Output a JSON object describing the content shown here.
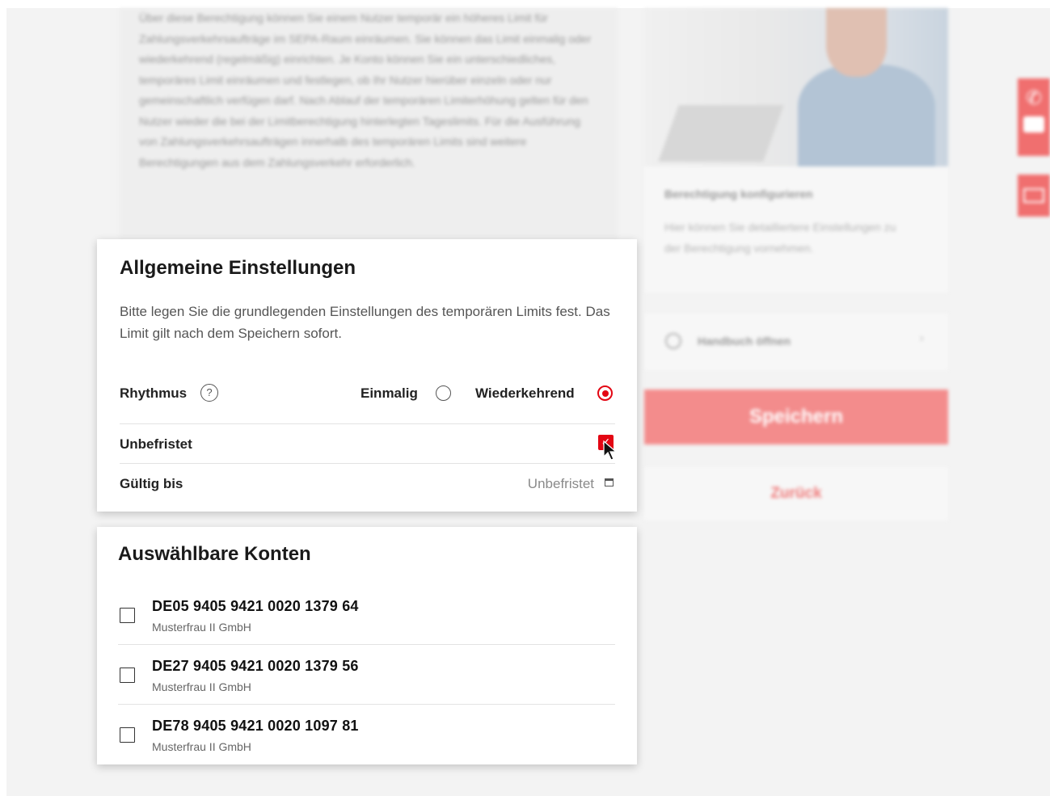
{
  "background": {
    "text_block": "Über diese Berechtigung können Sie einem Nutzer temporär ein höheres Limit für Zahlungsverkehrsaufträge im SEPA-Raum einräumen. Sie können das Limit einmalig oder wiederkehrend (regelmäßig) einrichten. Je Konto können Sie ein unterschiedliches, temporäres Limit einräumen und festlegen, ob Ihr Nutzer hierüber einzeln oder nur gemeinschaftlich verfügen darf. Nach Ablauf der temporären Limiterhöhung gelten für den Nutzer wieder die bei der Limitberechtigung hinterlegten Tageslimits. Für die Ausführung von Zahlungsverkehrsaufträgen innerhalb des temporären Limits sind weitere Berechtigungen aus dem Zahlungsverkehr erforderlich.",
    "config_card": {
      "title": "Berechtigung konfigurieren",
      "description": "Hier können Sie detailliertere Einstellungen zu der Berechtigung vornehmen."
    },
    "handbuch_label": "Handbuch öffnen",
    "save_label": "Speichern",
    "back_label": "Zurück"
  },
  "general": {
    "title": "Allgemeine Einstellungen",
    "description": "Bitte legen Sie die grundlegenden Einstellungen des temporären Limits fest. Das Limit gilt nach dem Speichern sofort.",
    "rhythm_label": "Rhythmus",
    "rhythm_options": [
      "Einmalig",
      "Wiederkehrend"
    ],
    "rhythm_selected": "Wiederkehrend",
    "unbefristet_label": "Unbefristet",
    "unbefristet_checked": true,
    "gueltig_label": "Gültig bis",
    "gueltig_value": "Unbefristet"
  },
  "accounts": {
    "title": "Auswählbare Konten",
    "items": [
      {
        "iban": "DE05 9405 9421 0020 1379 64",
        "owner": "Musterfrau II GmbH",
        "checked": false
      },
      {
        "iban": "DE27 9405 9421 0020 1379 56",
        "owner": "Musterfrau II GmbH",
        "checked": false
      },
      {
        "iban": "DE78 9405 9421 0020 1097 81",
        "owner": "Musterfrau II GmbH",
        "checked": false
      }
    ]
  },
  "colors": {
    "accent": "#e30613",
    "save_button": "#f38c8c",
    "side_button": "#f06f6f"
  },
  "icons": [
    "help-icon",
    "calendar-icon",
    "phone-icon",
    "chat-icon",
    "mail-icon",
    "clock-icon",
    "chevron-right-icon",
    "cursor-icon"
  ]
}
